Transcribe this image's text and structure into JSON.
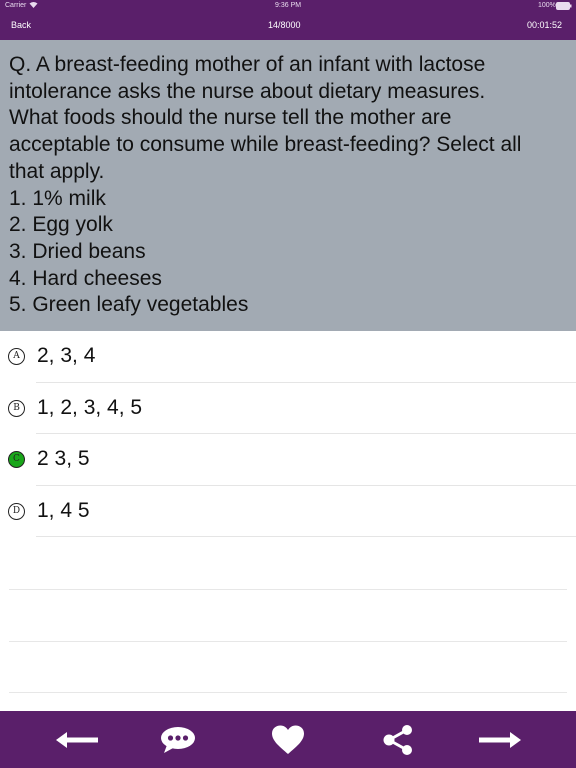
{
  "status": {
    "carrier": "Carrier",
    "time": "9:36 PM",
    "battery": "100%"
  },
  "nav": {
    "back_label": "Back",
    "progress": "14/8000",
    "timer": "00:01:52"
  },
  "question": {
    "lines": [
      "Q. A breast-feeding mother of an infant with lactose",
      "intolerance asks the nurse about dietary measures.",
      "What foods should the nurse tell the mother are",
      "acceptable to consume while breast-feeding? Select all",
      "that apply.",
      "1. 1% milk",
      "2. Egg yolk",
      "3. Dried beans",
      "4. Hard cheeses",
      "5. Green leafy vegetables"
    ]
  },
  "answers": [
    {
      "letter": "A",
      "text": "2, 3, 4",
      "selected": false
    },
    {
      "letter": "B",
      "text": "1, 2, 3, 4, 5",
      "selected": false
    },
    {
      "letter": "C",
      "text": "2 3, 5",
      "selected": true
    },
    {
      "letter": "D",
      "text": "1, 4 5",
      "selected": false
    }
  ],
  "toolbar": {
    "icons": [
      "arrow-left-icon",
      "comment-icon",
      "heart-icon",
      "share-icon",
      "arrow-right-icon"
    ]
  },
  "colors": {
    "bar": "#5a1f6a",
    "question_bg": "#a2aab3",
    "correct": "#19a61a"
  }
}
